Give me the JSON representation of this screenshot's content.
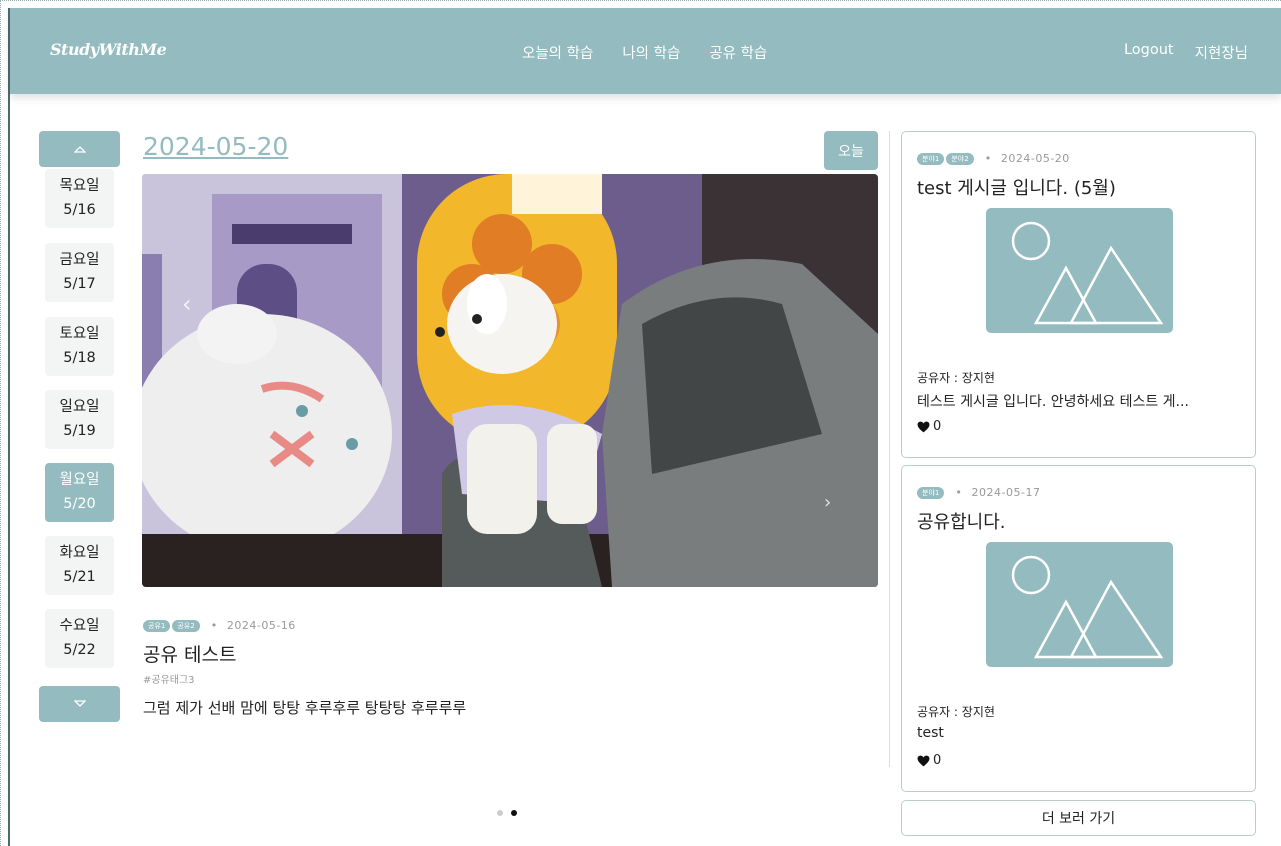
{
  "header": {
    "logo": "StudyWithMe",
    "nav": [
      "오늘의 학습",
      "나의 학습",
      "공유 학습"
    ],
    "logout": "Logout",
    "user": "지현장님"
  },
  "days": [
    {
      "weekday": "목요일",
      "date": "5/16",
      "active": false
    },
    {
      "weekday": "금요일",
      "date": "5/17",
      "active": false
    },
    {
      "weekday": "토요일",
      "date": "5/18",
      "active": false
    },
    {
      "weekday": "일요일",
      "date": "5/19",
      "active": false
    },
    {
      "weekday": "월요일",
      "date": "5/20",
      "active": true
    },
    {
      "weekday": "화요일",
      "date": "5/21",
      "active": false
    },
    {
      "weekday": "수요일",
      "date": "5/22",
      "active": false
    }
  ],
  "main": {
    "date_title": "2024-05-20",
    "today_label": "오늘",
    "post": {
      "tags": [
        "공유1",
        "공유2"
      ],
      "date": "2024-05-16",
      "title": "공유 테스트",
      "hashtag": "#공유태그3",
      "body": "그럼 제가 선배 맘에 탕탕 후루후루 탕탕탕 후루루루"
    },
    "carousel": {
      "slide_count": 2,
      "active_slide": 2
    }
  },
  "sidebar": {
    "cards": [
      {
        "tags": [
          "분야1",
          "분야2"
        ],
        "date": "2024-05-20",
        "title": "test 게시글 입니다. (5월)",
        "sharer": "공유자 : 장지현",
        "excerpt": "테스트 게시글 입니다. 안녕하세요 테스트 게...",
        "likes": "0"
      },
      {
        "tags": [
          "분야1"
        ],
        "date": "2024-05-17",
        "title": "공유합니다.",
        "sharer": "공유자 : 장지현",
        "excerpt": "test",
        "likes": "0"
      }
    ],
    "more_label": "더 보러 가기"
  },
  "colors": {
    "accent": "#94bbbf",
    "day_bg": "#f3f4f4"
  },
  "icons": {
    "up": "triangle-up-icon",
    "down": "triangle-down-icon",
    "like": "heart-icon",
    "thumb": "image-placeholder-icon"
  }
}
